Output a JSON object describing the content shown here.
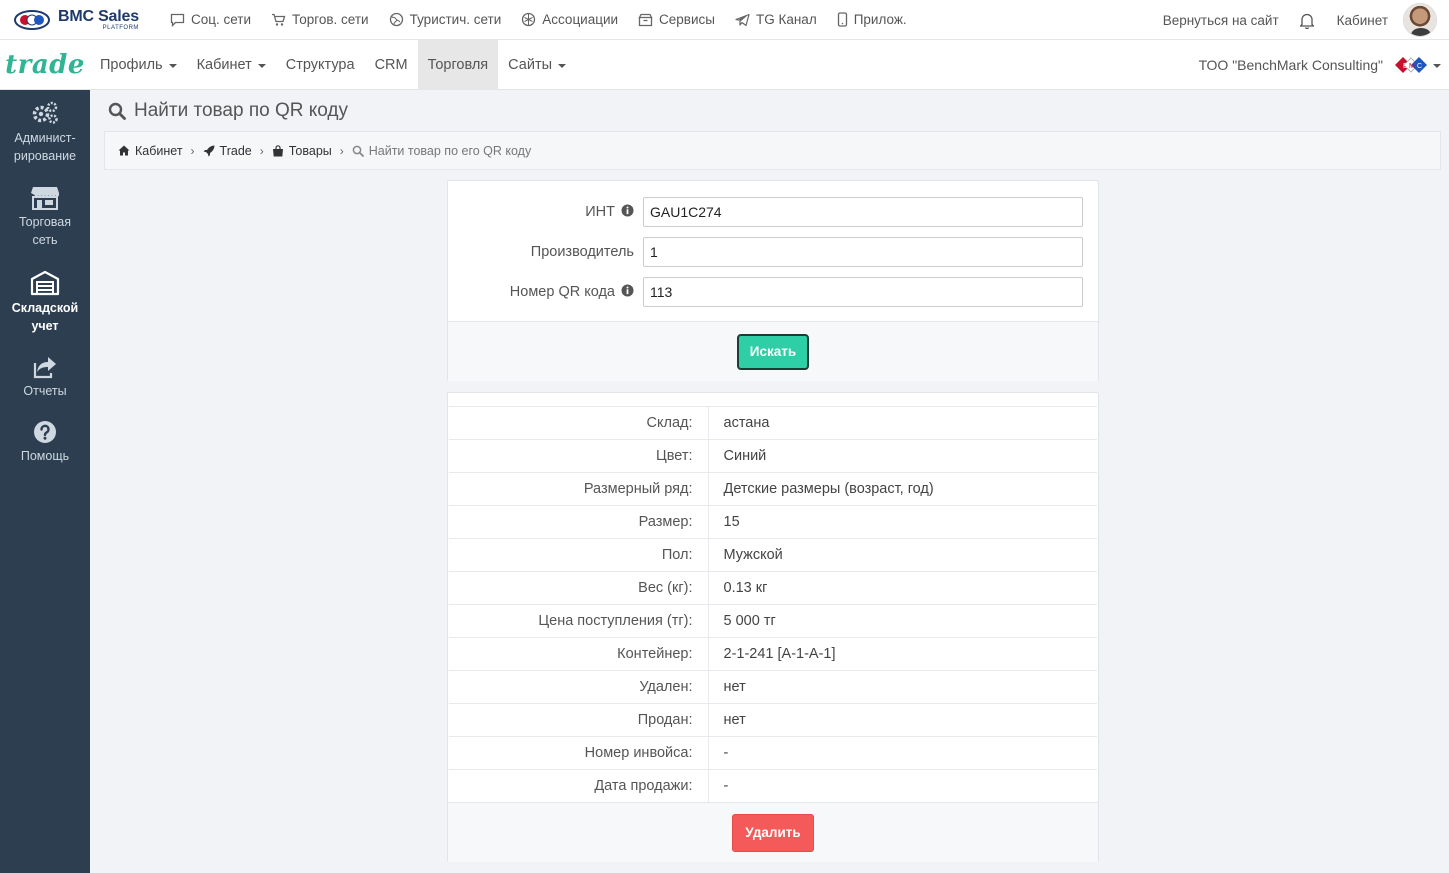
{
  "topbar": {
    "brand_name": "BMC Sales",
    "brand_sub": "PLATFORM",
    "nav": [
      {
        "label": "Соц. сети",
        "icon": "chat-icon"
      },
      {
        "label": "Торгов. сети",
        "icon": "cart-icon"
      },
      {
        "label": "Туристич. сети",
        "icon": "globe-icon"
      },
      {
        "label": "Ассоциации",
        "icon": "grid-circle-icon"
      },
      {
        "label": "Сервисы",
        "icon": "box-icon"
      },
      {
        "label": "TG Канал",
        "icon": "telegram-icon"
      },
      {
        "label": "Прилож.",
        "icon": "phone-icon"
      }
    ],
    "back_to_site": "Вернуться на сайт",
    "cabinet": "Кабинет"
  },
  "navbar2": {
    "logo": "trade",
    "items": [
      {
        "label": "Профиль",
        "dropdown": true
      },
      {
        "label": "Кабинет",
        "dropdown": true
      },
      {
        "label": "Структура",
        "dropdown": false
      },
      {
        "label": "CRM",
        "dropdown": false
      },
      {
        "label": "Торговля",
        "dropdown": false,
        "active": true
      },
      {
        "label": "Сайты",
        "dropdown": true
      }
    ],
    "company": "ТОО \"BenchMark Consulting\""
  },
  "sidebar": {
    "items": [
      {
        "line1": "Админист-",
        "line2": "рирование",
        "icon": "gears-icon"
      },
      {
        "line1": "Торговая",
        "line2": "сеть",
        "icon": "store-icon"
      },
      {
        "line1": "Складской",
        "line2": "учет",
        "icon": "warehouse-icon",
        "active": true
      },
      {
        "line1": "Отчеты",
        "line2": "",
        "icon": "share-icon"
      },
      {
        "line1": "Помощь",
        "line2": "",
        "icon": "help-icon"
      }
    ]
  },
  "page": {
    "title": "Найти товар по QR коду",
    "breadcrumb": [
      "Кабинет",
      "Trade",
      "Товары",
      "Найти товар по его QR коду"
    ]
  },
  "form": {
    "fields": [
      {
        "label": "ИНТ",
        "value": "GAU1C274",
        "info": true
      },
      {
        "label": "Производитель",
        "value": "1",
        "info": false
      },
      {
        "label": "Номер QR кода",
        "value": "113",
        "info": true
      }
    ],
    "search_button": "Искать"
  },
  "result": {
    "rows": [
      {
        "key": "Склад:",
        "value": "астана"
      },
      {
        "key": "Цвет:",
        "value": "Синий"
      },
      {
        "key": "Размерный ряд:",
        "value": "Детские размеры (возраст, год)"
      },
      {
        "key": "Размер:",
        "value": "15"
      },
      {
        "key": "Пол:",
        "value": "Мужской"
      },
      {
        "key": "Вес (кг):",
        "value": "0.13 кг"
      },
      {
        "key": "Цена поступления (тг):",
        "value": "5 000 тг"
      },
      {
        "key": "Контейнер:",
        "value": "2-1-241 [A-1-A-1]"
      },
      {
        "key": "Удален:",
        "value": "нет"
      },
      {
        "key": "Продан:",
        "value": "нет"
      },
      {
        "key": "Номер инвойса:",
        "value": "-"
      },
      {
        "key": "Дата продажи:",
        "value": "-"
      }
    ],
    "delete_button": "Удалить"
  },
  "colors": {
    "accent": "#2ecfa6",
    "sidebar": "#2c3e50",
    "danger": "#f55a5a",
    "brand": "#1e3a6d"
  }
}
